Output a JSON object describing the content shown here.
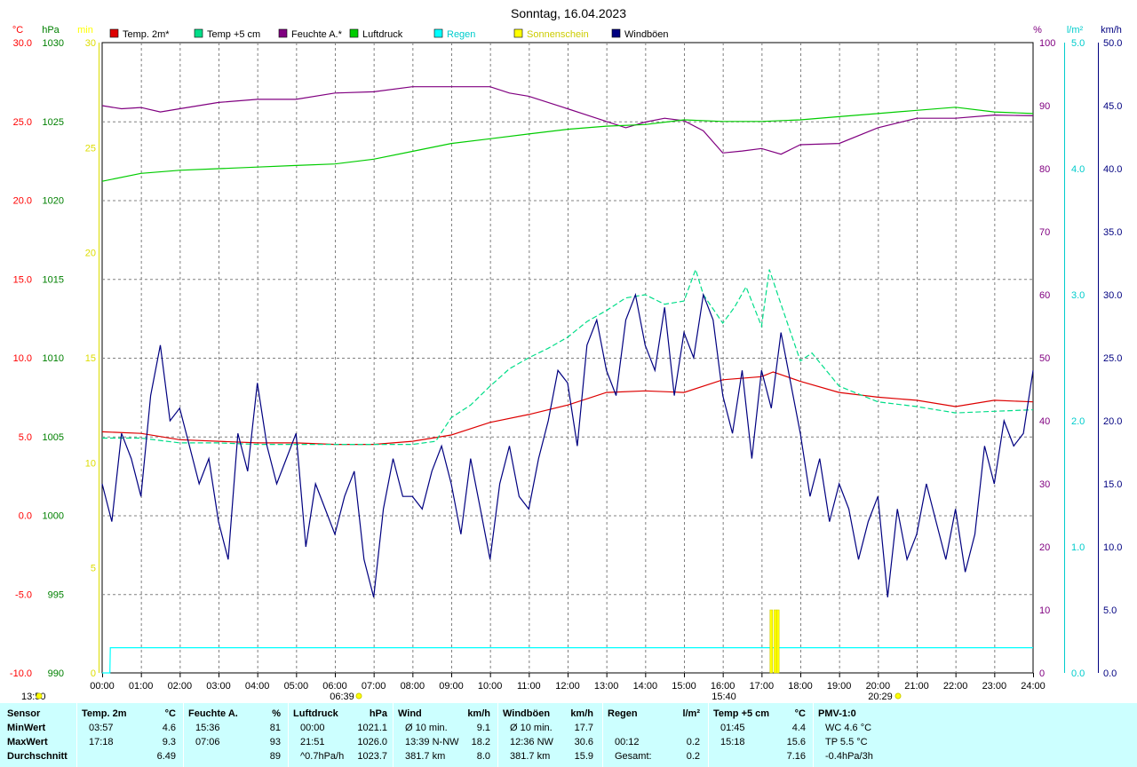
{
  "chart_data": {
    "type": "line",
    "title": "Sonntag, 16.04.2023",
    "x_ticks": [
      "00:00",
      "01:00",
      "02:00",
      "03:00",
      "04:00",
      "05:00",
      "06:00",
      "07:00",
      "08:00",
      "09:00",
      "10:00",
      "11:00",
      "12:00",
      "13:00",
      "14:00",
      "15:00",
      "16:00",
      "17:00",
      "18:00",
      "19:00",
      "20:00",
      "21:00",
      "22:00",
      "23:00",
      "24:00"
    ],
    "x_range_hours": [
      0,
      24
    ],
    "grid": true,
    "axes": {
      "temp": {
        "unit": "°C",
        "range": [
          -10,
          30
        ],
        "ticks": [
          "-10.0",
          "-5.0",
          "0.0",
          "5.0",
          "10.0",
          "15.0",
          "20.0",
          "25.0",
          "30.0"
        ],
        "color": "#ff0000"
      },
      "pressure": {
        "unit": "hPa",
        "range": [
          990,
          1030
        ],
        "ticks": [
          "990",
          "995",
          "1000",
          "1005",
          "1010",
          "1015",
          "1020",
          "1025",
          "1030"
        ],
        "color": "#008000"
      },
      "sunshine": {
        "unit": "min",
        "range": [
          0,
          30
        ],
        "ticks": [
          "0",
          "5",
          "10",
          "15",
          "20",
          "25",
          "30"
        ],
        "color": "#ffff00"
      },
      "humidity": {
        "unit": "%",
        "range": [
          0,
          100
        ],
        "ticks": [
          "0",
          "10",
          "20",
          "30",
          "40",
          "50",
          "60",
          "70",
          "80",
          "90",
          "100"
        ],
        "color": "#800080"
      },
      "rain": {
        "unit": "l/m²",
        "range": [
          0,
          5
        ],
        "ticks": [
          "0.0",
          "1.0",
          "2.0",
          "3.0",
          "4.0",
          "5.0"
        ],
        "color": "#00cccc"
      },
      "wind": {
        "unit": "km/h",
        "range": [
          0,
          50
        ],
        "ticks": [
          "0.0",
          "5.0",
          "10.0",
          "15.0",
          "20.0",
          "25.0",
          "30.0",
          "35.0",
          "40.0",
          "45.0",
          "50.0"
        ],
        "color": "#000080"
      }
    },
    "legend_placement": "top",
    "series": [
      {
        "name": "Temp. 2m*",
        "color": "#dd0000",
        "axis": "temp",
        "x": [
          0,
          1,
          2,
          3,
          4,
          5,
          6,
          7,
          8,
          9,
          10,
          11,
          12,
          13,
          14,
          15,
          16,
          17,
          17.3,
          18,
          19,
          20,
          21,
          22,
          23,
          24
        ],
        "y": [
          5.3,
          5.2,
          4.8,
          4.7,
          4.6,
          4.6,
          4.5,
          4.5,
          4.7,
          5.1,
          5.9,
          6.4,
          7.0,
          7.8,
          7.9,
          7.8,
          8.6,
          8.8,
          9.1,
          8.5,
          7.8,
          7.5,
          7.3,
          6.9,
          7.3,
          7.2
        ]
      },
      {
        "name": "Temp +5 cm",
        "color": "#00dd88",
        "dashed": true,
        "axis": "temp",
        "x": [
          0,
          1,
          2,
          3,
          4,
          5,
          6,
          7,
          8,
          8.6,
          9,
          9.5,
          10,
          10.5,
          11,
          11.5,
          12,
          12.5,
          13,
          13.5,
          14,
          14.5,
          15,
          15.3,
          15.5,
          16,
          16.3,
          16.6,
          17,
          17.2,
          17.5,
          18,
          18.3,
          19,
          20,
          21,
          22,
          23,
          24
        ],
        "y": [
          4.9,
          4.9,
          4.6,
          4.6,
          4.5,
          4.5,
          4.5,
          4.5,
          4.5,
          4.7,
          6.2,
          7.0,
          8.2,
          9.3,
          10.0,
          10.6,
          11.3,
          12.3,
          13.0,
          13.8,
          14.0,
          13.4,
          13.6,
          15.6,
          14.0,
          12.2,
          13.2,
          14.5,
          12.0,
          15.6,
          13.4,
          9.8,
          10.3,
          8.2,
          7.2,
          6.9,
          6.5,
          6.6,
          6.7
        ]
      },
      {
        "name": "Feuchte A.*",
        "color": "#800080",
        "axis": "humidity",
        "x": [
          0,
          0.5,
          1,
          1.5,
          2,
          3,
          4,
          5,
          6,
          7,
          8,
          9,
          10,
          10.5,
          11,
          12,
          13,
          13.5,
          14,
          14.5,
          15,
          15.5,
          16,
          16.5,
          17,
          17.5,
          18,
          19,
          20,
          21,
          22,
          23,
          24
        ],
        "y": [
          90,
          89.5,
          89.7,
          89,
          89.5,
          90.5,
          91,
          91,
          92,
          92.2,
          93,
          93,
          93,
          92,
          91.5,
          89.5,
          87.5,
          86.5,
          87.4,
          88,
          87.6,
          86,
          82.5,
          82.8,
          83.2,
          82.3,
          83.8,
          84,
          86.5,
          88,
          88,
          88.5,
          88.4
        ]
      },
      {
        "name": "Luftdruck",
        "color": "#00cc00",
        "axis": "pressure",
        "x": [
          0,
          1,
          2,
          3,
          4,
          5,
          6,
          7,
          8,
          9,
          10,
          11,
          12,
          13,
          14,
          15,
          16,
          17,
          18,
          19,
          20,
          21,
          22,
          23,
          24
        ],
        "y": [
          1021.2,
          1021.7,
          1021.9,
          1022.0,
          1022.1,
          1022.2,
          1022.3,
          1022.6,
          1023.1,
          1023.6,
          1023.9,
          1024.2,
          1024.5,
          1024.7,
          1024.8,
          1025.1,
          1025.0,
          1025.0,
          1025.1,
          1025.3,
          1025.5,
          1025.7,
          1025.9,
          1025.6,
          1025.5
        ]
      },
      {
        "name": "Regen",
        "color": "#00ffff",
        "axis": "rain",
        "x": [
          0,
          0.2,
          0.21,
          24
        ],
        "y": [
          0,
          0,
          0.2,
          0.2
        ]
      },
      {
        "name": "Sonnenschein",
        "color": "#ffff00",
        "axis": "sunshine",
        "bars": [
          {
            "x": 17.25,
            "y": 3
          },
          {
            "x": 17.35,
            "y": 3
          },
          {
            "x": 17.42,
            "y": 3
          }
        ]
      },
      {
        "name": "Windböen",
        "color": "#000080",
        "axis": "wind",
        "x": [
          0,
          0.25,
          0.5,
          0.75,
          1,
          1.25,
          1.5,
          1.75,
          2,
          2.25,
          2.5,
          2.75,
          3,
          3.25,
          3.5,
          3.75,
          4,
          4.25,
          4.5,
          4.75,
          5,
          5.25,
          5.5,
          5.75,
          6,
          6.25,
          6.5,
          6.75,
          7,
          7.25,
          7.5,
          7.75,
          8,
          8.25,
          8.5,
          8.75,
          9,
          9.25,
          9.5,
          9.75,
          10,
          10.25,
          10.5,
          10.75,
          11,
          11.25,
          11.5,
          11.75,
          12,
          12.25,
          12.5,
          12.75,
          13,
          13.25,
          13.5,
          13.75,
          14,
          14.25,
          14.5,
          14.75,
          15,
          15.25,
          15.5,
          15.75,
          16,
          16.25,
          16.5,
          16.75,
          17,
          17.25,
          17.5,
          17.75,
          18,
          18.25,
          18.5,
          18.75,
          19,
          19.25,
          19.5,
          19.75,
          20,
          20.25,
          20.5,
          20.75,
          21,
          21.25,
          21.5,
          21.75,
          22,
          22.25,
          22.5,
          22.75,
          23,
          23.25,
          23.5,
          23.75,
          24
        ],
        "y": [
          15,
          12,
          19,
          17,
          14,
          22,
          26,
          20,
          21,
          18,
          15,
          17,
          12,
          9,
          19,
          16,
          23,
          18,
          15,
          17,
          19,
          10,
          15,
          13,
          11,
          14,
          16,
          9,
          6,
          13,
          17,
          14,
          14,
          13,
          16,
          18,
          15,
          11,
          17,
          13,
          9,
          15,
          18,
          14,
          13,
          17,
          20,
          24,
          23,
          18,
          26,
          28,
          24,
          22,
          28,
          30,
          26,
          24,
          29,
          22,
          27,
          25,
          30,
          28,
          22,
          19,
          24,
          17,
          24,
          21,
          27,
          23,
          19,
          14,
          17,
          12,
          15,
          13,
          9,
          12,
          14,
          6,
          13,
          9,
          11,
          15,
          12,
          9,
          13,
          8,
          11,
          18,
          15,
          20,
          18,
          19,
          24
        ]
      }
    ]
  },
  "chart_labels": {
    "axis_units": [
      "°C",
      "hPa",
      "min",
      "%",
      "l/m²",
      "km/h"
    ],
    "time_markers": [
      "06:39",
      "15:40",
      "20:29"
    ],
    "left_bottom_marker": "13:50"
  },
  "stats": {
    "rows": [
      "MinWert",
      "MaxWert",
      "Durchschnitt"
    ],
    "sensor_label": "Sensor",
    "columns": [
      {
        "title": "Temp. 2m",
        "unit": "°C",
        "cells": [
          [
            "03:57",
            "4.6"
          ],
          [
            "17:18",
            "9.3"
          ],
          [
            "",
            "6.49"
          ]
        ]
      },
      {
        "title": "Feuchte A.",
        "unit": "%",
        "cells": [
          [
            "15:36",
            "81"
          ],
          [
            "07:06",
            "93"
          ],
          [
            "",
            "89"
          ]
        ]
      },
      {
        "title": "Luftdruck",
        "unit": "hPa",
        "cells": [
          [
            "00:00",
            "1021.1"
          ],
          [
            "21:51",
            "1026.0"
          ],
          [
            "^0.7hPa/h",
            "1023.7"
          ]
        ]
      },
      {
        "title": "Wind",
        "unit": "km/h",
        "cells": [
          [
            "Ø 10 min.",
            "9.1"
          ],
          [
            "13:39  N-NW",
            "18.2"
          ],
          [
            "381.7 km",
            "8.0"
          ]
        ]
      },
      {
        "title": "Windböen",
        "unit": "km/h",
        "cells": [
          [
            "Ø 10 min.",
            "17.7"
          ],
          [
            "12:36  NW",
            "30.6"
          ],
          [
            "381.7 km",
            "15.9"
          ]
        ]
      },
      {
        "title": "Regen",
        "unit": "l/m²",
        "cells": [
          [
            "",
            ""
          ],
          [
            "00:12",
            "0.2"
          ],
          [
            "Gesamt:",
            "0.2"
          ]
        ]
      },
      {
        "title": "Temp +5 cm",
        "unit": "°C",
        "cells": [
          [
            "01:45",
            "4.4"
          ],
          [
            "15:18",
            "15.6"
          ],
          [
            "",
            "7.16"
          ]
        ]
      },
      {
        "title": "PMV-1:0",
        "unit": "",
        "cells": [
          [
            "WC 4.6 °C",
            ""
          ],
          [
            "TP 5.5 °C",
            ""
          ],
          [
            "-0.4hPa/3h",
            ""
          ]
        ]
      }
    ]
  }
}
